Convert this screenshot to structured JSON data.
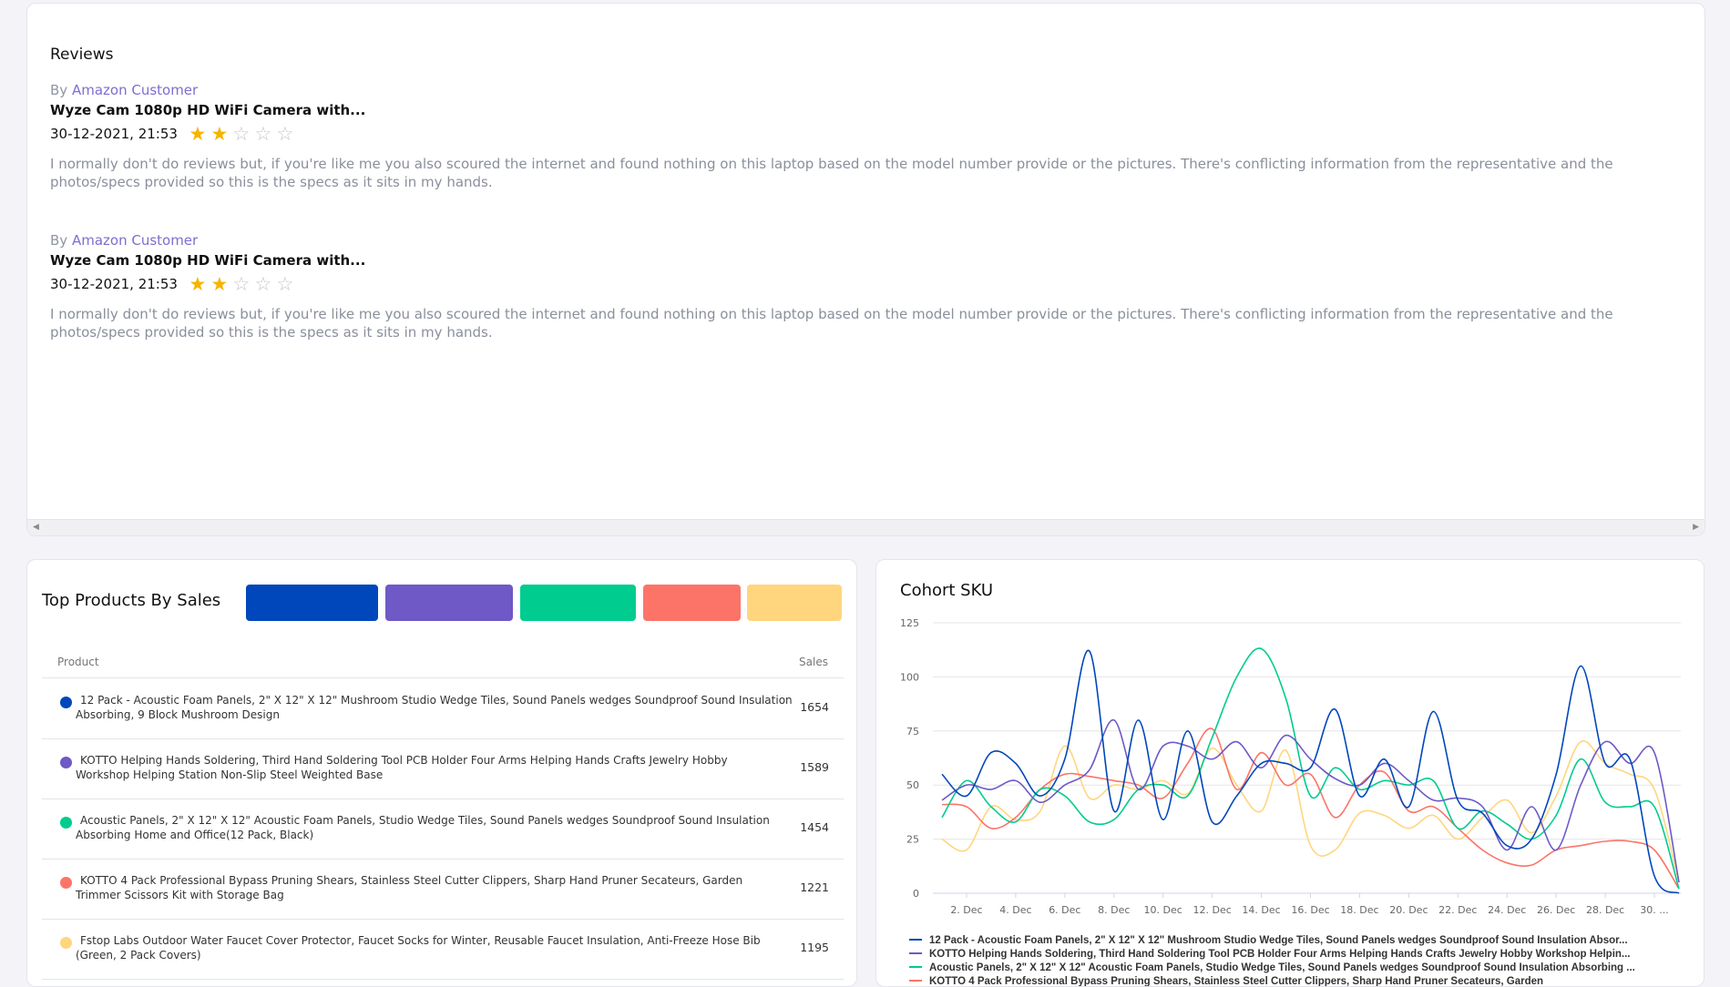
{
  "reviews": {
    "title": "Reviews",
    "items": [
      {
        "by_prefix": "By",
        "author": "Amazon Customer",
        "product": "Wyze Cam 1080p HD WiFi Camera with...",
        "date": "30-12-2021, 21:53",
        "rating": 2,
        "max_rating": 5,
        "text": "I normally don't do reviews but, if you're like me you also scoured the internet and found nothing on this laptop based on the model number provide or the pictures. There's conflicting information from the representative and the photos/specs provided so this is the specs as it sits in my hands."
      },
      {
        "by_prefix": "By",
        "author": "Amazon Customer",
        "product": "Wyze Cam 1080p HD WiFi Camera with...",
        "date": "30-12-2021, 21:53",
        "rating": 2,
        "max_rating": 5,
        "text": "I normally don't do reviews but, if you're like me you also scoured the internet and found nothing on this laptop based on the model number provide or the pictures. There's conflicting information from the representative and the photos/specs provided so this is the specs as it sits in my hands."
      }
    ]
  },
  "top_products": {
    "title": "Top Products By Sales",
    "col_product": "Product",
    "col_sales": "Sales",
    "swatch_colors": [
      "#0047bb",
      "#6e59c7",
      "#00cc8f",
      "#fc7468",
      "#ffd67e"
    ],
    "rows": [
      {
        "color": "#0047bb",
        "line1": "12 Pack - Acoustic Foam Panels, 2\" X 12\" X 12\" Mushroom Studio Wedge Tiles, Sound Panels wedges Soundproof Sound Insulation",
        "line2": "Absorbing, 9 Block Mushroom Design",
        "sales": "1654"
      },
      {
        "color": "#6e59c7",
        "line1": "KOTTO Helping Hands Soldering, Third Hand Soldering Tool PCB Holder Four Arms Helping Hands Crafts Jewelry Hobby",
        "line2": "Workshop Helping Station Non-Slip Steel Weighted Base",
        "sales": "1589"
      },
      {
        "color": "#00cc8f",
        "line1": "Acoustic Panels, 2\" X 12\" X 12\" Acoustic Foam Panels, Studio Wedge Tiles, Sound Panels wedges Soundproof Sound Insulation",
        "line2": "Absorbing Home and Office(12 Pack, Black)",
        "sales": "1454"
      },
      {
        "color": "#fc7468",
        "line1": "KOTTO 4 Pack Professional Bypass Pruning Shears, Stainless Steel Cutter Clippers, Sharp Hand Pruner Secateurs, Garden",
        "line2": "Trimmer Scissors Kit with Storage Bag",
        "sales": "1221"
      },
      {
        "color": "#ffd67e",
        "line1": "Fstop Labs Outdoor Water Faucet Cover Protector, Faucet Socks for Winter, Reusable Faucet Insulation, Anti-Freeze Hose Bib",
        "line2": "(Green, 2 Pack Covers)",
        "sales": "1195"
      }
    ]
  },
  "cohort": {
    "title": "Cohort SKU",
    "chart_data": {
      "type": "line",
      "ylim": [
        0,
        125
      ],
      "yticks": [
        "0",
        "25",
        "50",
        "75",
        "100",
        "125"
      ],
      "grid": true,
      "legend_position": "bottom",
      "x_tick_labels": [
        "2. Dec",
        "4. Dec",
        "6. Dec",
        "8. Dec",
        "10. Dec",
        "12. Dec",
        "14. Dec",
        "16. Dec",
        "18. Dec",
        "20. Dec",
        "22. Dec",
        "24. Dec",
        "26. Dec",
        "28. Dec",
        "30. ..."
      ],
      "x": [
        "1. Dec",
        "2. Dec",
        "3. Dec",
        "4. Dec",
        "5. Dec",
        "6. Dec",
        "7. Dec",
        "8. Dec",
        "9. Dec",
        "10. Dec",
        "11. Dec",
        "12. Dec",
        "13. Dec",
        "14. Dec",
        "15. Dec",
        "16. Dec",
        "17. Dec",
        "18. Dec",
        "19. Dec",
        "20. Dec",
        "21. Dec",
        "22. Dec",
        "23. Dec",
        "24. Dec",
        "25. Dec",
        "26. Dec",
        "27. Dec",
        "28. Dec",
        "29. Dec",
        "30. Dec",
        "31. Dec"
      ],
      "series": [
        {
          "name": "12 Pack - Acoustic Foam Panels, 2\" X 12\" X 12\" Mushroom Studio Wedge Tiles, Sound Panels wedges Soundproof Sound Insulation Absor...",
          "color": "#0047bb",
          "values": [
            55,
            45,
            65,
            60,
            45,
            62,
            112,
            38,
            80,
            34,
            75,
            33,
            45,
            60,
            60,
            58,
            85,
            45,
            62,
            40,
            84,
            43,
            37,
            22,
            25,
            55,
            105,
            60,
            62,
            8,
            0
          ]
        },
        {
          "name": "KOTTO Helping Hands Soldering, Third Hand Soldering Tool PCB Holder Four Arms Helping Hands Crafts Jewelry Hobby Workshop Helpin...",
          "color": "#6e59c7",
          "values": [
            43,
            50,
            48,
            52,
            42,
            50,
            57,
            80,
            48,
            68,
            68,
            62,
            70,
            58,
            73,
            62,
            53,
            50,
            60,
            52,
            43,
            44,
            40,
            20,
            40,
            20,
            50,
            70,
            60,
            65,
            5
          ]
        },
        {
          "name": "Acoustic Panels, 2\" X 12\" X 12\" Acoustic Foam Panels, Studio Wedge Tiles, Sound Panels wedges Soundproof Sound Insulation Absorbing ...",
          "color": "#00cc8f",
          "values": [
            35,
            52,
            40,
            33,
            48,
            45,
            33,
            34,
            48,
            50,
            45,
            72,
            100,
            113,
            90,
            45,
            58,
            48,
            52,
            50,
            52,
            30,
            38,
            32,
            25,
            36,
            62,
            42,
            40,
            40,
            2
          ]
        },
        {
          "name": "KOTTO 4 Pack Professional Bypass Pruning Shears, Stainless Steel Cutter Clippers, Sharp Hand Pruner Secateurs, Garden",
          "color": "#fc7468",
          "values": [
            41,
            40,
            30,
            35,
            48,
            55,
            54,
            52,
            50,
            44,
            60,
            76,
            48,
            65,
            50,
            55,
            35,
            50,
            56,
            38,
            40,
            30,
            20,
            14,
            13,
            20,
            22,
            24,
            24,
            20,
            2
          ]
        },
        {
          "name": "Fstop Labs Outdoor Water Faucet Cover Protector, Faucet Socks for Winter, Reusable Faucet Insulation, Anti-Freeze Hose Bib",
          "color": "#ffd67e",
          "values": [
            25,
            20,
            40,
            34,
            38,
            68,
            44,
            50,
            48,
            52,
            46,
            67,
            50,
            38,
            66,
            22,
            20,
            37,
            36,
            30,
            36,
            25,
            35,
            43,
            28,
            45,
            70,
            60,
            55,
            48,
            5
          ]
        }
      ]
    }
  }
}
